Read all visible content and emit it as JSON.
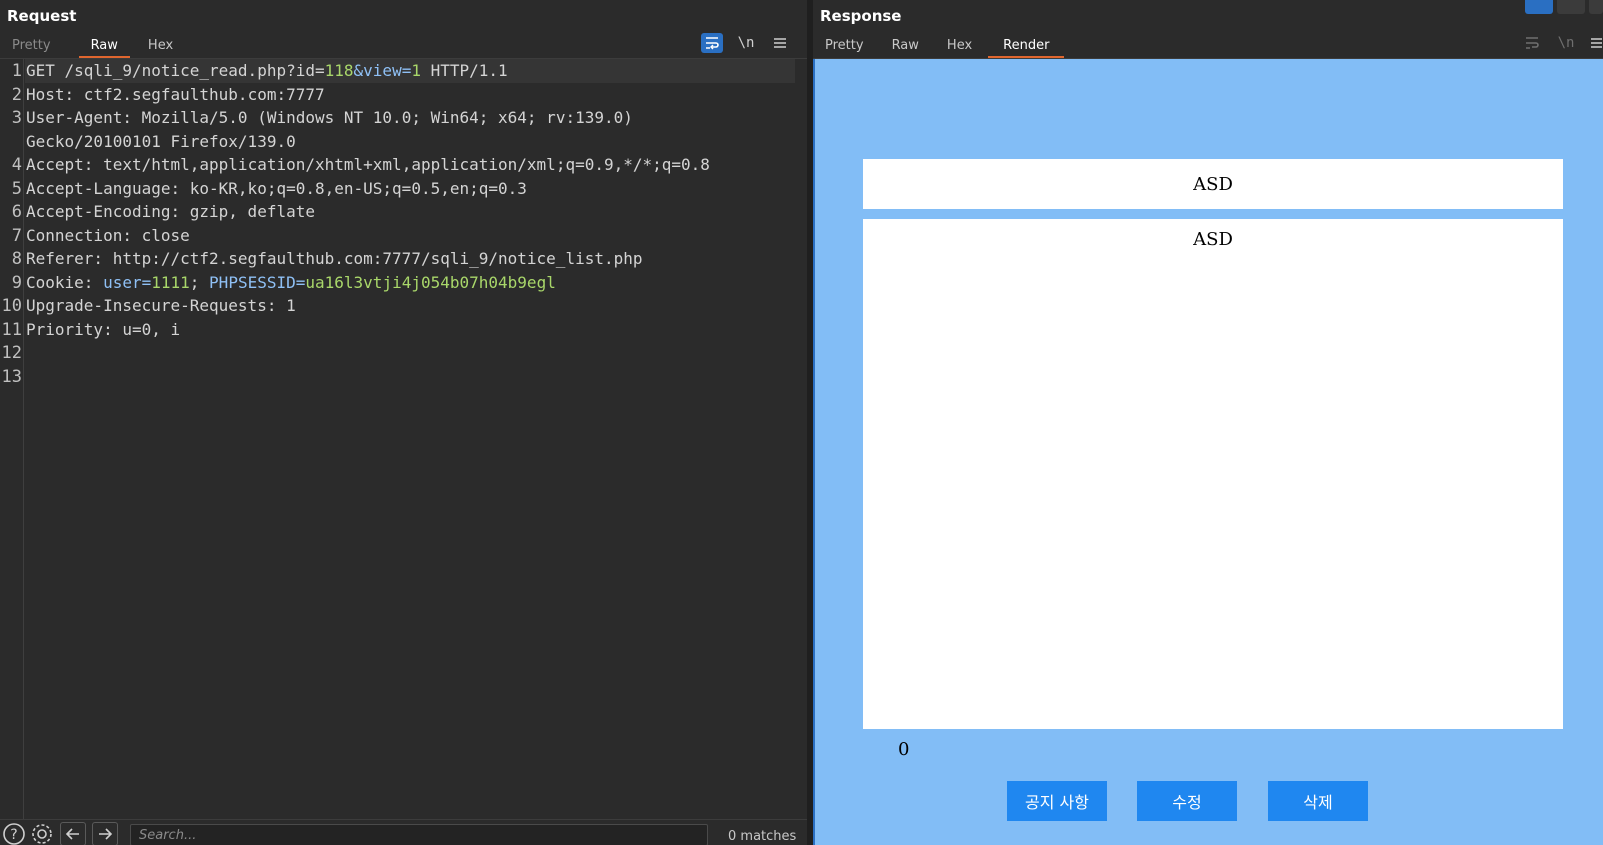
{
  "request": {
    "title": "Request",
    "tabs": [
      "Pretty",
      "Raw",
      "Hex"
    ],
    "active_tab": "Raw",
    "tools": {
      "wrap_icon": "wrap-icon",
      "newline_label": "\\n",
      "menu_icon": "menu-icon"
    },
    "lines": [
      {
        "n": "1",
        "parts": [
          [
            "GET /sqli_9/notice_read.php?id=",
            "key"
          ],
          [
            "118",
            "num"
          ],
          [
            "&view=",
            "attr"
          ],
          [
            "1",
            "num"
          ],
          [
            " HTTP/1.1",
            "key"
          ]
        ]
      },
      {
        "n": "2",
        "parts": [
          [
            "Host:",
            "key"
          ],
          [
            " ctf2.segfaulthub.com:7777",
            "val"
          ]
        ]
      },
      {
        "n": "3",
        "parts": [
          [
            "User-Agent:",
            "key"
          ],
          [
            " Mozilla/5.0 (Windows NT 10.0; Win64; x64; rv:139.0)",
            "val"
          ]
        ]
      },
      {
        "n": "",
        "parts": [
          [
            "Gecko/20100101 Firefox/139.0",
            "val"
          ]
        ]
      },
      {
        "n": "4",
        "parts": [
          [
            "Accept:",
            "key"
          ],
          [
            " text/html,application/xhtml+xml,application/xml;q=0.9,*/*;q=0.8",
            "val"
          ]
        ]
      },
      {
        "n": "5",
        "parts": [
          [
            "Accept-Language:",
            "key"
          ],
          [
            " ko-KR,ko;q=0.8,en-US;q=0.5,en;q=0.3",
            "val"
          ]
        ]
      },
      {
        "n": "6",
        "parts": [
          [
            "Accept-Encoding:",
            "key"
          ],
          [
            " gzip, deflate",
            "val"
          ]
        ]
      },
      {
        "n": "7",
        "parts": [
          [
            "Connection:",
            "key"
          ],
          [
            " close",
            "val"
          ]
        ]
      },
      {
        "n": "8",
        "parts": [
          [
            "Referer:",
            "key"
          ],
          [
            " http://ctf2.segfaulthub.com:7777/sqli_9/notice_list.php",
            "val"
          ]
        ]
      },
      {
        "n": "9",
        "parts": [
          [
            "Cookie:",
            "key"
          ],
          [
            " ",
            "val"
          ],
          [
            "user=",
            "attr"
          ],
          [
            "1111",
            "num"
          ],
          [
            "; ",
            "val"
          ],
          [
            "PHPSESSID=",
            "attr"
          ],
          [
            "ua16l3vtji4j054b07h04b9egl",
            "num"
          ]
        ]
      },
      {
        "n": "10",
        "parts": [
          [
            "Upgrade-Insecure-Requests:",
            "key"
          ],
          [
            " 1",
            "val"
          ]
        ]
      },
      {
        "n": "11",
        "parts": [
          [
            "Priority:",
            "key"
          ],
          [
            " u=0, i",
            "val"
          ]
        ]
      },
      {
        "n": "12",
        "parts": []
      },
      {
        "n": "13",
        "parts": []
      }
    ],
    "search": {
      "placeholder": "Search...",
      "value": "",
      "matches": "0 matches"
    }
  },
  "response": {
    "title": "Response",
    "tabs": [
      "Pretty",
      "Raw",
      "Hex",
      "Render"
    ],
    "active_tab": "Render",
    "render": {
      "title": "ASD",
      "content": "ASD",
      "views": "0",
      "buttons": [
        "공지 사항",
        "수정",
        "삭제"
      ]
    }
  },
  "colors": {
    "accent_tab": "#e0662f",
    "render_bg": "#82bdf6",
    "button_bg": "#1f87f0",
    "highlight_num": "#a9d76a",
    "highlight_attr": "#8fc0f5"
  }
}
